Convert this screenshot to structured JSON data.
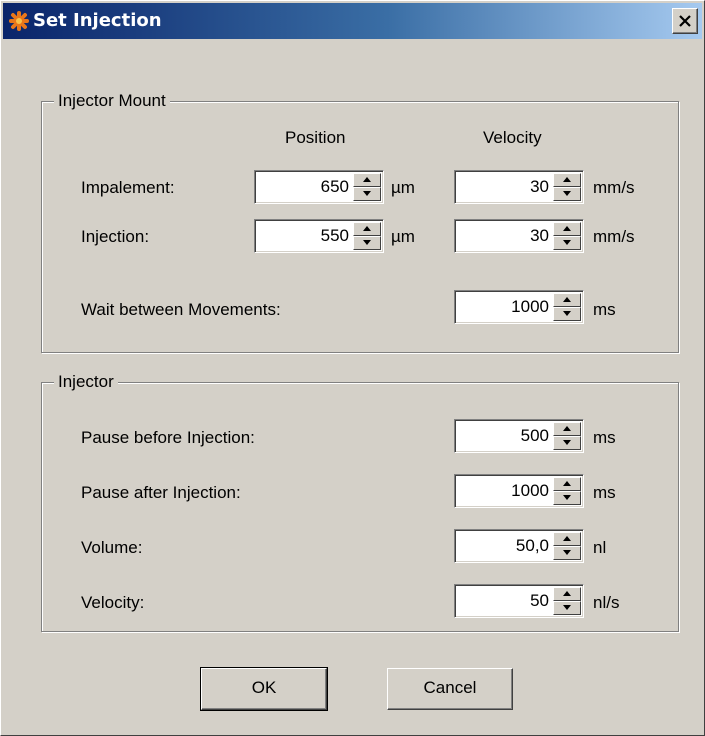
{
  "window": {
    "title": "Set Injection"
  },
  "mount": {
    "group_title": "Injector Mount",
    "position_header": "Position",
    "velocity_header": "Velocity",
    "rows": [
      {
        "label": "Impalement:",
        "position": "650",
        "position_unit": "µm",
        "velocity": "30",
        "velocity_unit": "mm/s"
      },
      {
        "label": "Injection:",
        "position": "550",
        "position_unit": "µm",
        "velocity": "30",
        "velocity_unit": "mm/s"
      }
    ],
    "wait": {
      "label": "Wait between Movements:",
      "value": "1000",
      "unit": "ms"
    }
  },
  "injector": {
    "group_title": "Injector",
    "rows": [
      {
        "label": "Pause before Injection:",
        "value": "500",
        "unit": "ms"
      },
      {
        "label": "Pause after Injection:",
        "value": "1000",
        "unit": "ms"
      },
      {
        "label": "Volume:",
        "value": "50,0",
        "unit": "nl"
      },
      {
        "label": "Velocity:",
        "value": "50",
        "unit": "nl/s"
      }
    ]
  },
  "buttons": {
    "ok": "OK",
    "cancel": "Cancel"
  }
}
